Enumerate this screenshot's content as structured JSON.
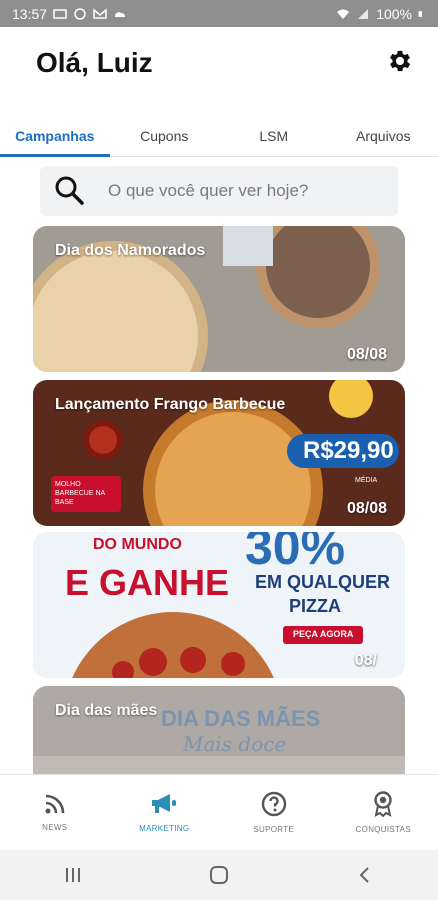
{
  "statusbar": {
    "time": "13:57",
    "battery": "100%"
  },
  "header": {
    "greeting": "Olá, Luiz"
  },
  "tabs": [
    {
      "label": "Campanhas",
      "active": true
    },
    {
      "label": "Cupons",
      "active": false
    },
    {
      "label": "LSM",
      "active": false
    },
    {
      "label": "Arquivos",
      "active": false
    }
  ],
  "search": {
    "placeholder": "O que você quer ver hoje?"
  },
  "cards": [
    {
      "title": "Dia dos Namorados",
      "date": "08/08"
    },
    {
      "title": "Lançamento Frango Barbecue",
      "date": "08/08",
      "price": "R$29,90",
      "price_sub": "MÉDIA",
      "badge": "MOLHO BARBECUE NA BASE"
    },
    {
      "title": "",
      "date": "08/",
      "line1": "DO MUNDO",
      "line2": "E GANHE",
      "line3": "30%",
      "line4": "EM QUALQUER",
      "line5": "PIZZA",
      "cta": "PEÇA AGORA"
    },
    {
      "title": "Dia das mães",
      "date": "",
      "line1": "DIA DAS MÃES",
      "line2": "Mais doce"
    }
  ],
  "bottomnav": [
    {
      "label": "NEWS",
      "icon": "rss-icon",
      "active": false
    },
    {
      "label": "MARKETING",
      "icon": "megaphone-icon",
      "active": true
    },
    {
      "label": "SUPORTE",
      "icon": "help-icon",
      "active": false
    },
    {
      "label": "CONQUISTAS",
      "icon": "award-icon",
      "active": false
    }
  ],
  "colors": {
    "accent": "#1e6fc4",
    "marketing": "#2b8fb5",
    "statusbar": "#8e8e8e"
  }
}
